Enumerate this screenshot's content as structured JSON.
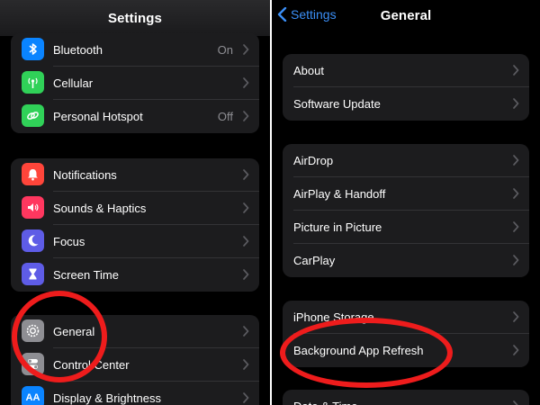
{
  "left": {
    "title": "Settings",
    "group1": [
      {
        "label": "Bluetooth",
        "value": "On",
        "icon": "bluetooth-icon",
        "color": "#0a84ff"
      },
      {
        "label": "Cellular",
        "value": "",
        "icon": "antenna-icon",
        "color": "#30d158"
      },
      {
        "label": "Personal Hotspot",
        "value": "Off",
        "icon": "hotspot-link-icon",
        "color": "#30d158"
      }
    ],
    "group2": [
      {
        "label": "Notifications",
        "icon": "bell-icon",
        "color": "#ff453a"
      },
      {
        "label": "Sounds & Haptics",
        "icon": "speaker-icon",
        "color": "#ff375f"
      },
      {
        "label": "Focus",
        "icon": "moon-icon",
        "color": "#5e5ce6"
      },
      {
        "label": "Screen Time",
        "icon": "hourglass-icon",
        "color": "#5e5ce6"
      }
    ],
    "group3": [
      {
        "label": "General",
        "icon": "gear-icon",
        "color": "#8e8e93"
      },
      {
        "label": "Control Center",
        "icon": "toggles-icon",
        "color": "#8e8e93"
      },
      {
        "label": "Display & Brightness",
        "icon": "text-size-icon",
        "color": "#0a84ff",
        "icon_text": "AA"
      }
    ]
  },
  "right": {
    "back_label": "Settings",
    "title": "General",
    "group1": [
      "About",
      "Software Update"
    ],
    "group2": [
      "AirDrop",
      "AirPlay & Handoff",
      "Picture in Picture",
      "CarPlay"
    ],
    "group3": [
      "iPhone Storage",
      "Background App Refresh"
    ],
    "group4": [
      "Date & Time"
    ]
  },
  "annotation_color": "#ee1c1c"
}
